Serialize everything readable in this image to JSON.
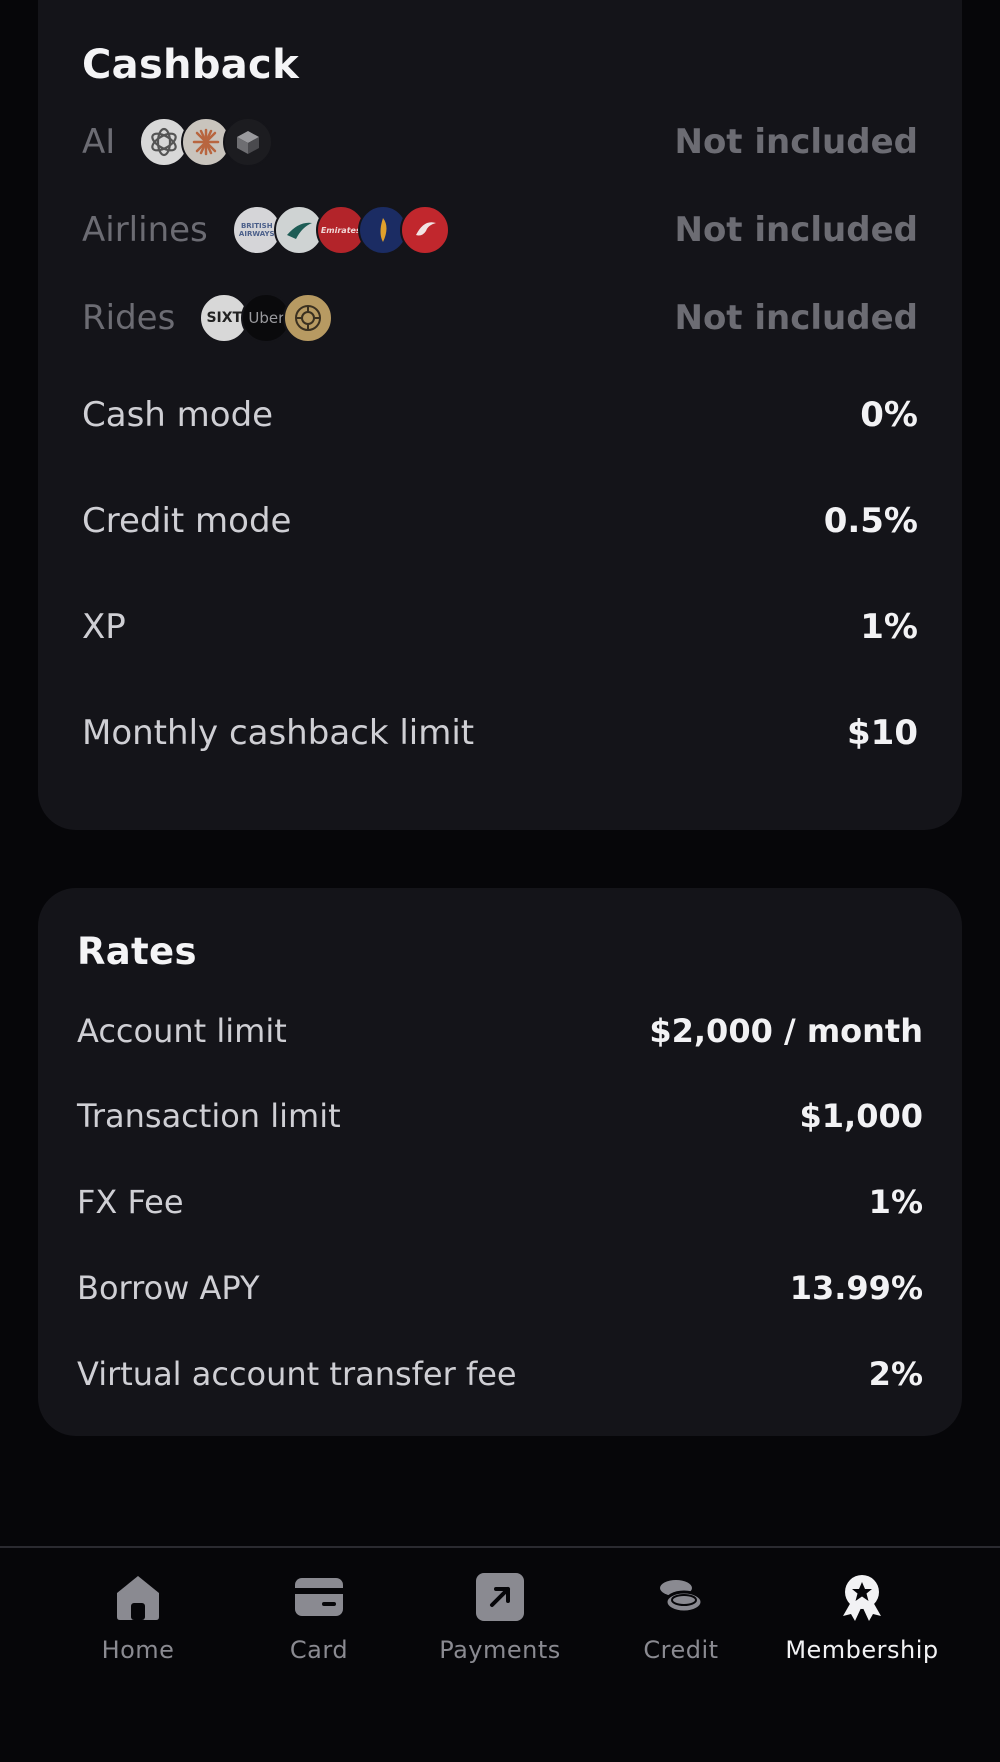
{
  "cashback": {
    "title": "Cashback",
    "ai": {
      "label": "AI",
      "value": "Not included",
      "logos": [
        "openai-logo",
        "anthropic-logo",
        "perplexity-logo"
      ]
    },
    "airlines": {
      "label": "Airlines",
      "value": "Not included",
      "logos": [
        "british-airways-logo",
        "cathay-pacific-logo",
        "emirates-logo",
        "singapore-airlines-logo",
        "turkish-airlines-logo"
      ],
      "logo_texts": {
        "british_airways": "BRITISH AIRWAYS",
        "emirates": "Emirates"
      }
    },
    "rides": {
      "label": "Rides",
      "value": "Not included",
      "logos": [
        "sixt-logo",
        "uber-logo",
        "bolt-logo"
      ],
      "logo_texts": {
        "sixt": "SIXT",
        "uber": "Uber"
      }
    },
    "rows": [
      {
        "label": "Cash mode",
        "value": "0%"
      },
      {
        "label": "Credit mode",
        "value": "0.5%"
      },
      {
        "label": "XP",
        "value": "1%"
      },
      {
        "label": "Monthly cashback limit",
        "value": "$10"
      }
    ]
  },
  "rates": {
    "title": "Rates",
    "rows": [
      {
        "label": "Account limit",
        "value": "$2,000 / month"
      },
      {
        "label": "Transaction limit",
        "value": "$1,000"
      },
      {
        "label": "FX Fee",
        "value": "1%"
      },
      {
        "label": "Borrow APY",
        "value": "13.99%"
      },
      {
        "label": "Virtual account transfer fee",
        "value": "2%"
      }
    ]
  },
  "nav": {
    "items": [
      {
        "label": "Home",
        "icon": "home-icon"
      },
      {
        "label": "Card",
        "icon": "card-icon"
      },
      {
        "label": "Payments",
        "icon": "payments-icon"
      },
      {
        "label": "Credit",
        "icon": "credit-icon"
      },
      {
        "label": "Membership",
        "icon": "membership-icon"
      }
    ],
    "active": "Membership"
  },
  "colors": {
    "background": "#060609",
    "card": "#141419",
    "text_primary": "#f2f2f4",
    "text_dim": "#6c6c73",
    "nav_inactive": "#8a8a91"
  }
}
